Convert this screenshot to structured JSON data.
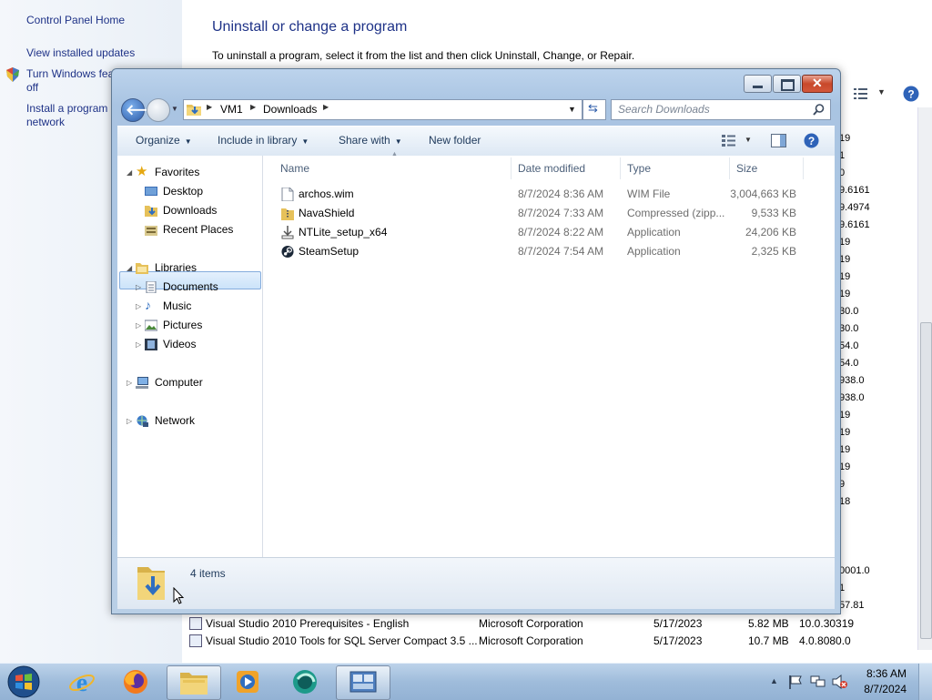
{
  "control_panel": {
    "sidebar": {
      "home": "Control Panel Home",
      "updates": "View installed updates",
      "features_l1": "Turn Windows fea",
      "features_l2": "off",
      "install_l1": "Install a program",
      "install_l2": "network"
    },
    "title": "Uninstall or change a program",
    "description": "To uninstall a program, select it from the list and then click Uninstall, Change, or Repair.",
    "version_fragments": [
      "19",
      "1",
      "0",
      "9.6161",
      "9.4974",
      "9.6161",
      "19",
      "19",
      "19",
      "19",
      "30.0",
      "30.0",
      "54.0",
      "54.0",
      "938.0",
      "938.0",
      "19",
      "19",
      "19",
      "19",
      "9",
      "18",
      "0001.0",
      "1",
      "57.81"
    ],
    "rows": [
      {
        "name": "Visual Studio 2010 Prerequisites - English",
        "publisher": "Microsoft Corporation",
        "installed": "5/17/2023",
        "size": "5.82 MB",
        "version": "10.0.30319"
      },
      {
        "name": "Visual Studio 2010 Tools for SQL Server Compact 3.5 ...",
        "publisher": "Microsoft Corporation",
        "installed": "5/17/2023",
        "size": "10.7 MB",
        "version": "4.0.8080.0"
      }
    ]
  },
  "explorer": {
    "breadcrumb": [
      "VM1",
      "Downloads"
    ],
    "search_placeholder": "Search Downloads",
    "commands": {
      "organize": "Organize",
      "include": "Include in library",
      "share": "Share with",
      "new_folder": "New folder"
    },
    "nav": {
      "favorites": "Favorites",
      "desktop": "Desktop",
      "downloads": "Downloads",
      "recent": "Recent Places",
      "libraries": "Libraries",
      "documents": "Documents",
      "music": "Music",
      "pictures": "Pictures",
      "videos": "Videos",
      "computer": "Computer",
      "network": "Network"
    },
    "columns": {
      "name": "Name",
      "date": "Date modified",
      "type": "Type",
      "size": "Size"
    },
    "files": [
      {
        "name": "archos.wim",
        "date": "8/7/2024 8:36 AM",
        "type": "WIM File",
        "size": "3,004,663 KB",
        "icon": "file-icon"
      },
      {
        "name": "NavaShield",
        "date": "8/7/2024 7:33 AM",
        "type": "Compressed (zipp...",
        "size": "9,533 KB",
        "icon": "zip-folder-icon"
      },
      {
        "name": "NTLite_setup_x64",
        "date": "8/7/2024 8:22 AM",
        "type": "Application",
        "size": "24,206 KB",
        "icon": "installer-icon"
      },
      {
        "name": "SteamSetup",
        "date": "8/7/2024 7:54 AM",
        "type": "Application",
        "size": "2,325 KB",
        "icon": "steam-icon"
      }
    ],
    "status": "4 items"
  },
  "taskbar": {
    "time": "8:36 AM",
    "date": "8/7/2024"
  },
  "colors": {
    "link": "#1e3287",
    "accent": "#2a5aa8",
    "taskbar": "#9fbcdb"
  }
}
